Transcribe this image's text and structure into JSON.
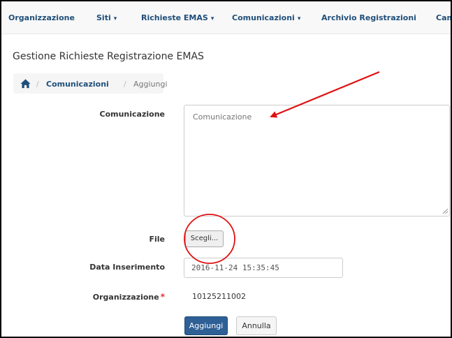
{
  "nav": {
    "items": [
      {
        "label": "Organizzazione",
        "has_caret": false
      },
      {
        "label": "Siti",
        "has_caret": true
      },
      {
        "label": "Richieste EMAS",
        "has_caret": true
      },
      {
        "label": "Comunicazioni",
        "has_caret": true
      },
      {
        "label": "Archivio Registrazioni",
        "has_caret": false
      },
      {
        "label": "Cambi",
        "has_caret": false
      }
    ],
    "caret": "▾"
  },
  "page": {
    "title": "Gestione Richieste Registrazione EMAS"
  },
  "breadcrumb": {
    "home_icon": "home-icon",
    "separator": "/",
    "link": "Comunicazioni",
    "current": "Aggiungi"
  },
  "form": {
    "comunicazione": {
      "label": "Comunicazione",
      "placeholder": "Comunicazione",
      "value": ""
    },
    "file": {
      "label": "File",
      "button_label": "Scegli..."
    },
    "data_inserimento": {
      "label": "Data Inserimento",
      "value": "2016-11-24 15:35:45"
    },
    "organizzazione": {
      "label": "Organizzazione",
      "required_mark": "*",
      "value": "10125211002"
    }
  },
  "buttons": {
    "submit": "Aggiungi",
    "cancel": "Annulla"
  },
  "colors": {
    "link": "#1f4e79",
    "primary": "#2e5f95",
    "annotation": "#e01010",
    "required": "#e0313b"
  }
}
